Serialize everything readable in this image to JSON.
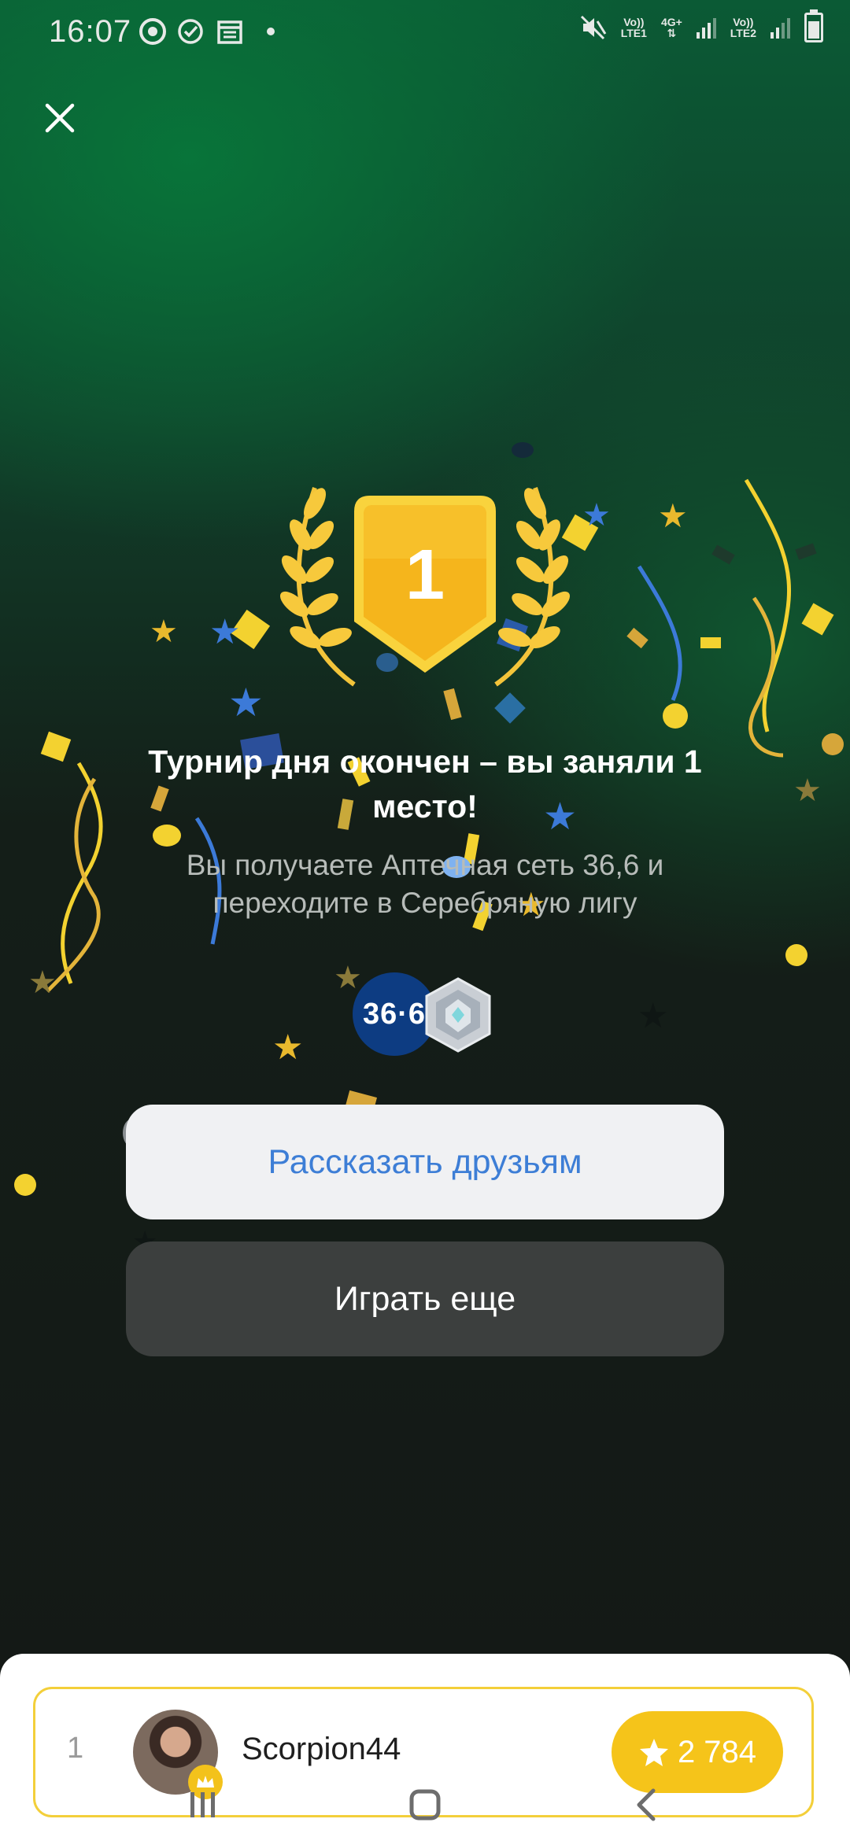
{
  "status_bar": {
    "time": "16:07",
    "icons": [
      "chrome-icon",
      "check-circle-icon",
      "calendar-icon",
      "dot-icon"
    ],
    "sim1": {
      "label_top": "Vo))",
      "label_bottom": "LTE1"
    },
    "sim2_data": {
      "label_top": "4G+",
      "label_bottom": ""
    },
    "sim2": {
      "label_top": "Vo))",
      "label_bottom": "LTE2"
    },
    "right_icons": [
      "mute-vibrate-icon",
      "signal-icon",
      "battery-icon"
    ]
  },
  "header": {
    "close_icon": "close-icon"
  },
  "result": {
    "place_number": "1",
    "title": "Турнир дня окончен – вы заняли 1 место!",
    "subtitle": "Вы получаете Аптечная сеть 36,6 и переходите в Серебряную лигу",
    "reward_logo_text": "36·6"
  },
  "buttons": {
    "share": "Рассказать друзьям",
    "replay": "Играть еще"
  },
  "leaderboard": {
    "rank": "1",
    "username": "Scorpion44",
    "score": "2 784"
  },
  "colors": {
    "accent_gold": "#f5c41a",
    "share_text": "#3d7ed6",
    "bg_green": "#0b5a35"
  }
}
